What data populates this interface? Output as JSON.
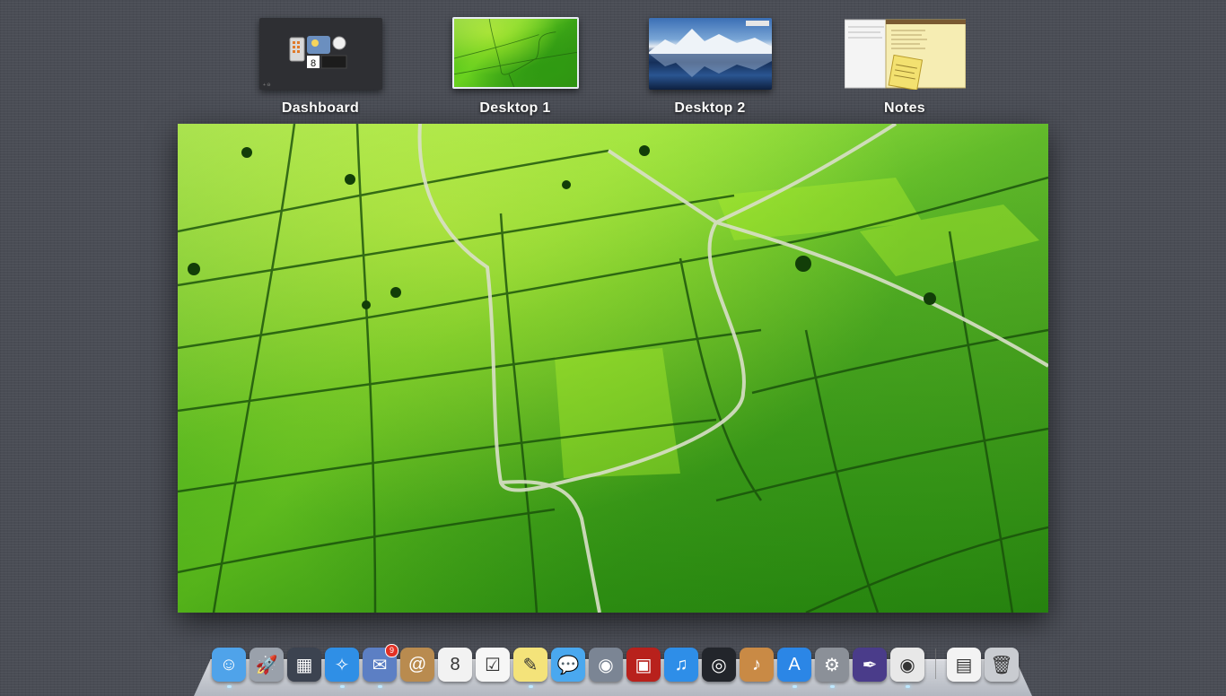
{
  "spaces": [
    {
      "id": "dashboard",
      "label": "Dashboard"
    },
    {
      "id": "desktop1",
      "label": "Desktop 1"
    },
    {
      "id": "desktop2",
      "label": "Desktop 2"
    },
    {
      "id": "notes",
      "label": "Notes"
    }
  ],
  "dashboard_widget": {
    "calendar_day": "8"
  },
  "dock": {
    "items": [
      {
        "name": "finder-icon",
        "label": "Finder",
        "color": "#4fa3ea",
        "glyph": "☺",
        "running": true
      },
      {
        "name": "launchpad-icon",
        "label": "Launchpad",
        "color": "#9aa1ab",
        "glyph": "🚀",
        "running": false
      },
      {
        "name": "mission-control-icon",
        "label": "Mission Control",
        "color": "#3c4350",
        "glyph": "▦",
        "running": false
      },
      {
        "name": "safari-icon",
        "label": "Safari",
        "color": "#2f8fe6",
        "glyph": "✧",
        "running": true
      },
      {
        "name": "mail-icon",
        "label": "Mail",
        "color": "#5c7fc4",
        "glyph": "✉",
        "running": true,
        "badge": "9"
      },
      {
        "name": "contacts-icon",
        "label": "Contacts",
        "color": "#b98b4f",
        "glyph": "@",
        "running": false
      },
      {
        "name": "calendar-icon",
        "label": "Calendar",
        "color": "#f2f2f2",
        "glyph": "8",
        "running": false
      },
      {
        "name": "reminders-icon",
        "label": "Reminders",
        "color": "#f6f6f6",
        "glyph": "☑",
        "running": false
      },
      {
        "name": "notes-icon",
        "label": "Notes",
        "color": "#f4e37a",
        "glyph": "✎",
        "running": true
      },
      {
        "name": "messages-icon",
        "label": "Messages",
        "color": "#4aa8ef",
        "glyph": "💬",
        "running": false
      },
      {
        "name": "facetime-icon",
        "label": "FaceTime",
        "color": "#7b8594",
        "glyph": "◉",
        "running": false
      },
      {
        "name": "photo-booth-icon",
        "label": "Photo Booth",
        "color": "#b8211c",
        "glyph": "▣",
        "running": false
      },
      {
        "name": "itunes-icon",
        "label": "iTunes",
        "color": "#2e8ee8",
        "glyph": "♫",
        "running": false
      },
      {
        "name": "aperture-icon",
        "label": "Aperture",
        "color": "#22252b",
        "glyph": "◎",
        "running": false
      },
      {
        "name": "garageband-icon",
        "label": "GarageBand",
        "color": "#c98a45",
        "glyph": "♪",
        "running": false
      },
      {
        "name": "app-store-icon",
        "label": "App Store",
        "color": "#2b86e6",
        "glyph": "A",
        "running": true
      },
      {
        "name": "system-preferences-icon",
        "label": "System Preferences",
        "color": "#8b9098",
        "glyph": "⚙",
        "running": true
      },
      {
        "name": "xcode-instruments-icon",
        "label": "Instruments",
        "color": "#4a3c8a",
        "glyph": "✒",
        "running": false
      },
      {
        "name": "chrome-icon",
        "label": "Google Chrome",
        "color": "#e8e8e8",
        "glyph": "◉",
        "running": true
      }
    ],
    "right_items": [
      {
        "name": "document-icon",
        "label": "Document",
        "color": "#f3f3f3",
        "glyph": "▤",
        "running": false
      },
      {
        "name": "trash-icon",
        "label": "Trash",
        "color": "#c9ccd1",
        "glyph": "🗑",
        "running": false
      }
    ]
  }
}
